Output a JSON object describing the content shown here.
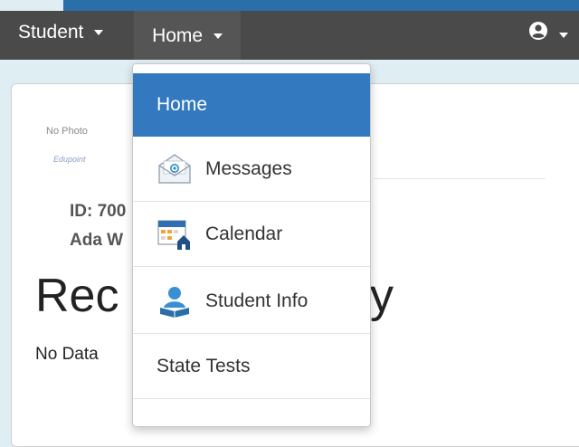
{
  "navbar": {
    "student_label": "Student",
    "home_label": "Home",
    "user_icon": "user-circle-icon"
  },
  "card": {
    "no_photo": "No Photo",
    "logo_text": "Edupoint",
    "id_line": "ID: 700",
    "name_line": "Ada W",
    "title_start": "Rec",
    "title_end": "y",
    "no_data": "No Data"
  },
  "dropdown": {
    "items": [
      {
        "label": "Home",
        "icon": null,
        "active": true
      },
      {
        "label": "Messages",
        "icon": "envelope-icon"
      },
      {
        "label": "Calendar",
        "icon": "calendar-icon"
      },
      {
        "label": "Student Info",
        "icon": "student-reading-icon"
      },
      {
        "label": "State Tests",
        "icon": null
      }
    ]
  },
  "colors": {
    "navbar": "#4a4a4a",
    "active_item": "#3279c0",
    "top_strip": "#2a6faa",
    "background": "#dfeef3"
  }
}
